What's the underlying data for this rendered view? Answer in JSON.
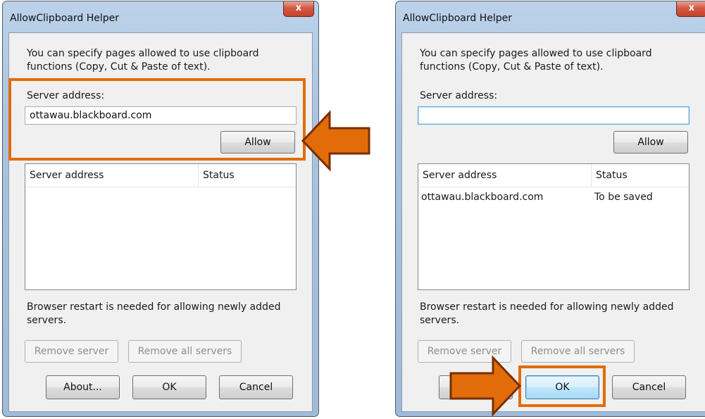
{
  "dialogs": [
    {
      "title": "AllowClipboard Helper",
      "close_label": "x",
      "description": "You can specify pages allowed to use clipboard functions (Copy, Cut & Paste of text).",
      "server_label": "Server address:",
      "server_value": "ottawau.blackboard.com",
      "allow_label": "Allow",
      "list": {
        "columns": [
          "Server address",
          "Status"
        ],
        "rows": []
      },
      "restart_note": "Browser restart is needed for allowing newly added servers.",
      "remove_server_label": "Remove server",
      "remove_all_label": "Remove all servers",
      "about_label": "About...",
      "ok_label": "OK",
      "cancel_label": "Cancel"
    },
    {
      "title": "AllowClipboard Helper",
      "close_label": "x",
      "description": "You can specify pages allowed to use clipboard functions (Copy, Cut & Paste of text).",
      "server_label": "Server address:",
      "server_value": "",
      "allow_label": "Allow",
      "list": {
        "columns": [
          "Server address",
          "Status"
        ],
        "rows": [
          {
            "server": "ottawau.blackboard.com",
            "status": "To be saved"
          }
        ]
      },
      "restart_note": "Browser restart is needed for allowing newly added servers.",
      "remove_server_label": "Remove server",
      "remove_all_label": "Remove all servers",
      "ok_label": "OK",
      "cancel_label": "Cancel"
    }
  ],
  "annotations": {
    "highlight_color": "#e36c0a",
    "arrow_fill": "#e36c0a",
    "arrow_outline": "#7a2e00"
  }
}
